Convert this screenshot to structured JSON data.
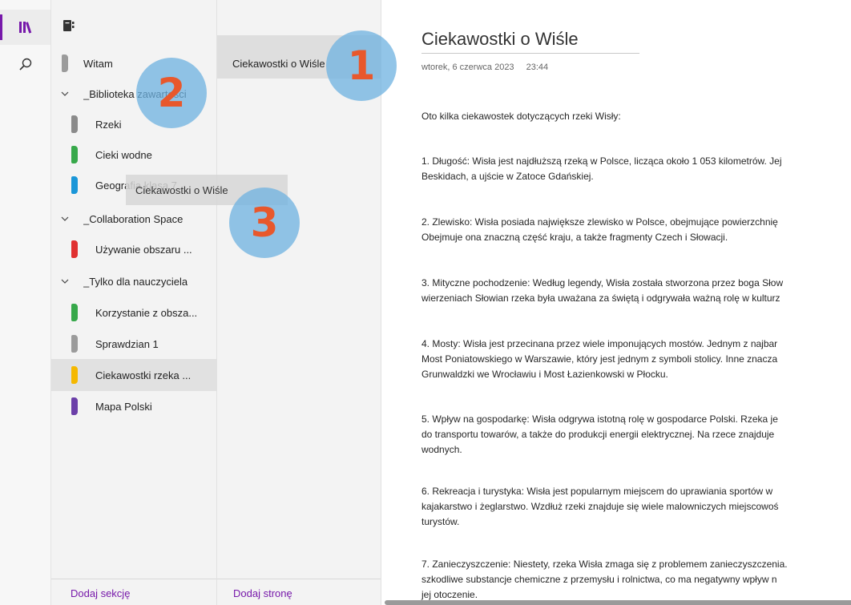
{
  "sections_pane": {
    "items": [
      {
        "label": "Witam",
        "color": "#9b9b9b",
        "level": 0,
        "type": "section"
      },
      {
        "label": "_Biblioteka zawartości",
        "type": "group",
        "expanded": true
      },
      {
        "label": "Rzeki",
        "color": "#8a8a8a",
        "level": 1,
        "type": "section"
      },
      {
        "label": "Cieki wodne",
        "color": "#37a84a",
        "level": 1,
        "type": "section"
      },
      {
        "label": "Geografia klasa 7",
        "color": "#1a96d8",
        "level": 1,
        "type": "section"
      },
      {
        "label": "_Collaboration Space",
        "type": "group",
        "expanded": true
      },
      {
        "label": "Używanie obszaru ...",
        "color": "#e03030",
        "level": 1,
        "type": "section"
      },
      {
        "label": "_Tylko dla nauczyciela",
        "type": "group",
        "expanded": true
      },
      {
        "label": "Korzystanie z obsza...",
        "color": "#37a84a",
        "level": 1,
        "type": "section"
      },
      {
        "label": "Sprawdzian 1",
        "color": "#9b9b9b",
        "level": 1,
        "type": "section"
      },
      {
        "label": "Ciekawostki rzeka ...",
        "color": "#f5b800",
        "level": 1,
        "type": "section",
        "selected": true
      },
      {
        "label": "Mapa Polski",
        "color": "#6b3fa8",
        "level": 1,
        "type": "section"
      }
    ],
    "add_section": "Dodaj sekcję"
  },
  "pages_pane": {
    "pages": [
      {
        "label": "Ciekawostki o Wiśle",
        "selected": true
      }
    ],
    "add_page": "Dodaj stronę"
  },
  "page": {
    "title": "Ciekawostki o Wiśle",
    "date": "wtorek, 6 czerwca 2023",
    "time": "23:44",
    "intro": "Oto kilka ciekawostek dotyczących rzeki Wisły:",
    "paragraphs": [
      "1. Długość: Wisła jest najdłuższą rzeką w Polsce, licząca około 1 053 kilometrów. Jej\nBeskidach, a ujście w Zatoce Gdańskiej.",
      "2. Zlewisko: Wisła posiada największe zlewisko w Polsce, obejmujące powierzchnię\nObejmuje ona znaczną część kraju, a także fragmenty Czech i Słowacji.",
      "3. Mityczne pochodzenie: Według legendy, Wisła została stworzona przez boga Słow\nwierzeniach Słowian rzeka była uważana za świętą i odgrywała ważną rolę w kulturz",
      "4. Mosty: Wisła jest przecinana przez wiele imponujących mostów. Jednym z najbar\nMost Poniatowskiego w Warszawie, który jest jednym z symboli stolicy. Inne znacza\nGrunwaldzki we Wrocławiu i Most Łazienkowski w Płocku.",
      "5. Wpływ na gospodarkę: Wisła odgrywa istotną rolę w gospodarce Polski. Rzeka je\ndo transportu towarów, a także do produkcji energii elektrycznej. Na rzece znajduje\nwodnych.",
      "6. Rekreacja i turystyka: Wisła jest popularnym miejscem do uprawiania sportów w\nkajakarstwo i żeglarstwo. Wzdłuż rzeki znajduje się wiele malowniczych miejscowoś\nturystów.",
      "7. Zanieczyszczenie: Niestety, rzeka Wisła zmaga się z problemem zanieczyszczenia.\nszkodliwe substancje chemiczne z przemysłu i rolnictwa, co ma negatywny wpływ n\njej otoczenie."
    ]
  },
  "overlay": {
    "markers": [
      "1",
      "2",
      "3"
    ],
    "drag_label": "Ciekawostki o Wiśle",
    "marker_color": "#e8582c"
  },
  "colors": {
    "accent": "#7719aa"
  }
}
